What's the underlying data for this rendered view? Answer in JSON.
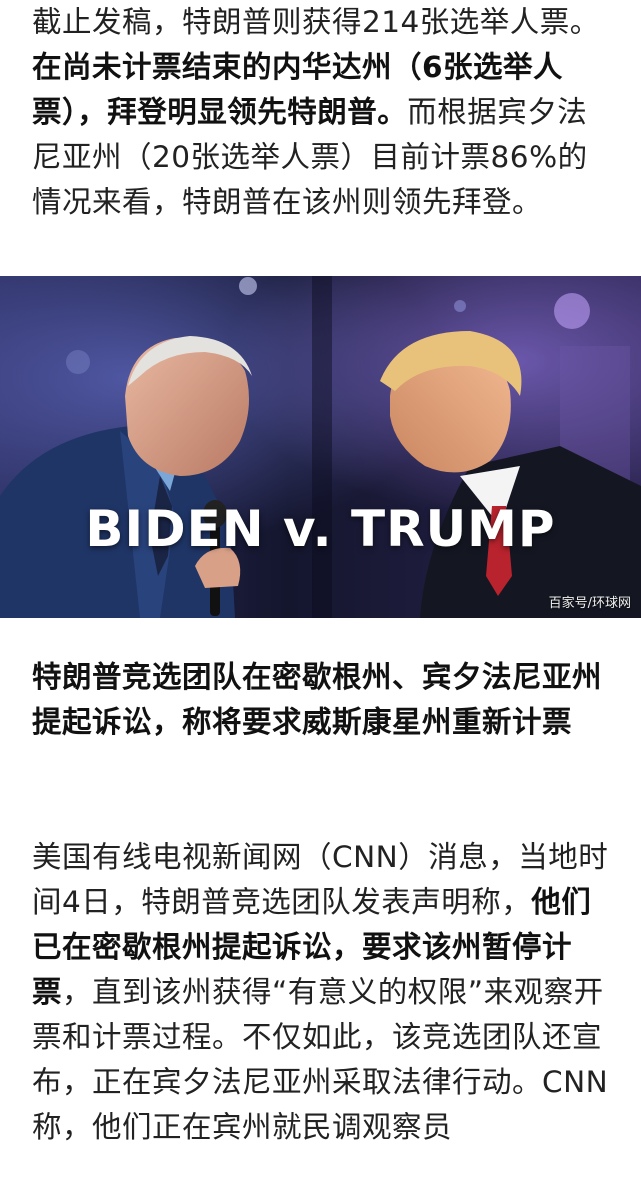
{
  "intro": {
    "lead": "截止发稿，特朗普则获得214张选举人票。",
    "bold": "在尚未计票结束的内华达州（6张选举人票），拜登明显领先特朗普。",
    "tail": "而根据宾夕法尼亚州（20张选举人票）目前计票86%的情况来看，特朗普在该州则领先拜登。"
  },
  "image": {
    "title": "BIDEN v. TRUMP",
    "credit": "百家号/环球网"
  },
  "section": {
    "heading": "特朗普竞选团队在密歇根州、宾夕法尼亚州提起诉讼，称将要求威斯康星州重新计票"
  },
  "body": {
    "lead": "美国有线电视新闻网（CNN）消息，当地时间4日，特朗普竞选团队发表声明称，",
    "bold": "他们已在密歇根州提起诉讼，要求该州暂停计票",
    "tail": "，直到该州获得“有意义的权限”来观察开票和计票过程。不仅如此，该竞选团队还宣布，正在宾夕法尼亚州采取法律行动。CNN称，他们正在宾州就民调观察员"
  }
}
